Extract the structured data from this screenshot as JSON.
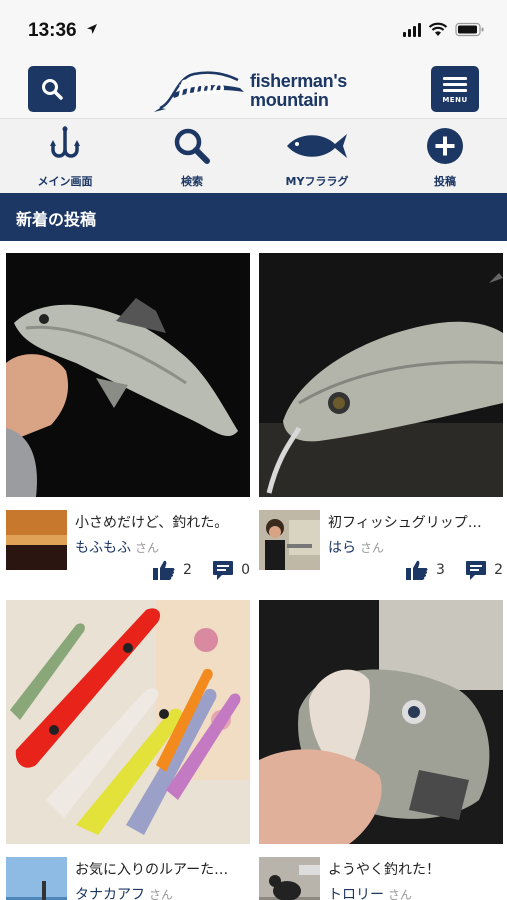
{
  "status": {
    "time": "13:36"
  },
  "header": {
    "brand_logo": "fimo",
    "brand_name_1": "fisherman's",
    "brand_name_2": "mountain",
    "menu_label": "MENU"
  },
  "nav": [
    {
      "label": "メイン画面",
      "icon": "fishhook-icon"
    },
    {
      "label": "検索",
      "icon": "search-icon"
    },
    {
      "label": "MYフララグ",
      "icon": "fish-icon"
    },
    {
      "label": "投稿",
      "icon": "plus-circle-icon"
    }
  ],
  "section": {
    "title": "新着の投稿"
  },
  "posts": [
    {
      "title": "小さめだけど、釣れた。",
      "user": "もふもふ",
      "honorific": "さん",
      "likes": "2",
      "comments": "0"
    },
    {
      "title": "初フィッシュグリップ…",
      "user": "はら",
      "honorific": "さん",
      "likes": "3",
      "comments": "2"
    },
    {
      "title": "お気に入りのルアーた…",
      "user": "タナカアフ",
      "honorific": "さん"
    },
    {
      "title": "ようやく釣れた！",
      "user": "トロリー",
      "honorific": "さん"
    }
  ]
}
